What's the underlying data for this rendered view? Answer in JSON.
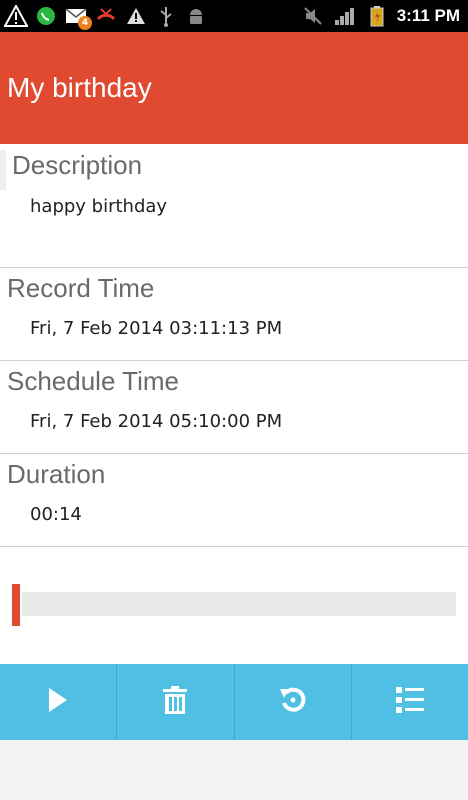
{
  "status_bar": {
    "time": "3:11 PM",
    "notification_badge": "4",
    "icons_left": [
      "warning-icon",
      "whatsapp-icon",
      "email-icon",
      "missed-call-icon",
      "warning-icon",
      "usb-icon",
      "android-debug-icon"
    ],
    "icons_right": [
      "mute-icon",
      "signal-icon",
      "battery-icon"
    ]
  },
  "header": {
    "title": "My birthday"
  },
  "details": {
    "description_label": "Description",
    "description_value": "happy birthday",
    "record_time_label": "Record Time",
    "record_time_value": "Fri, 7 Feb 2014 03:11:13 PM",
    "schedule_time_label": "Schedule Time",
    "schedule_time_value": "Fri, 7 Feb 2014 05:10:00 PM",
    "duration_label": "Duration",
    "duration_value": "00:14"
  },
  "playback": {
    "progress": 0,
    "accent_color": "#e04a30"
  },
  "toolbar": {
    "buttons": [
      "play-icon",
      "delete-icon",
      "replay-icon",
      "list-icon"
    ],
    "color": "#4fc0e3"
  }
}
